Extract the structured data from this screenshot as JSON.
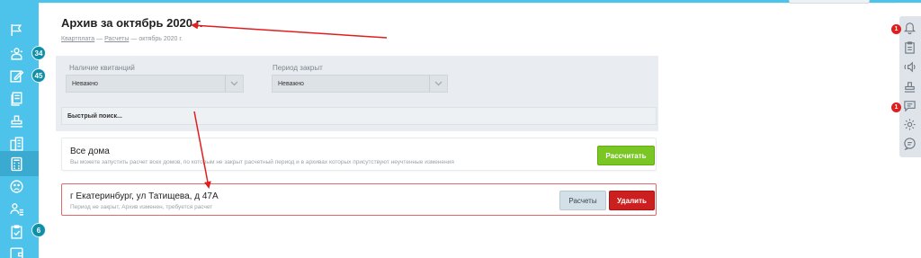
{
  "sidebar": {
    "items": [
      {
        "icon": "flag-icon"
      },
      {
        "icon": "groups-icon",
        "badge": "34"
      },
      {
        "icon": "edit-note-icon",
        "badge": "45"
      },
      {
        "icon": "documents-icon"
      },
      {
        "icon": "stamp-icon"
      },
      {
        "icon": "buildings-icon"
      },
      {
        "icon": "calculator-icon"
      },
      {
        "icon": "sad-face-icon"
      },
      {
        "icon": "users-list-icon"
      },
      {
        "icon": "clipboard-check-icon",
        "badge": "6"
      },
      {
        "icon": "wallet-icon"
      }
    ]
  },
  "right_rail": {
    "items": [
      {
        "icon": "bell-icon",
        "badge": "1"
      },
      {
        "icon": "clipboard-icon"
      },
      {
        "icon": "speaker-icon"
      },
      {
        "icon": "stamp-icon"
      },
      {
        "icon": "chat-icon",
        "badge": "1"
      },
      {
        "icon": "gear-icon"
      },
      {
        "icon": "support-chat-icon"
      }
    ]
  },
  "page": {
    "title": "Архив за октябрь 2020 г.",
    "breadcrumb": [
      "Квартплата",
      "Расчеты",
      "октябрь 2020 г."
    ],
    "breadcrumb_sep": "—"
  },
  "filters": {
    "receipts_label": "Наличие квитанций",
    "receipts_value": "Неважно",
    "period_label": "Период закрыт",
    "period_value": "Неважно",
    "quick_search_placeholder": "Быстрый поиск..."
  },
  "cards": {
    "all_houses": {
      "title": "Все дома",
      "subtitle": "Вы можете запустить расчет всех домов, по которым не закрыт расчетный период и в архивах которых присутствуют неучтенные изменения",
      "button": "Рассчитать"
    },
    "address": {
      "title": "г Екатеринбург, ул Татищева, д 47А",
      "subtitle": "Период не закрыт, Архив изменен, требуется расчет",
      "calc_button": "Расчеты",
      "delete_button": "Удалить"
    }
  },
  "colors": {
    "sidebar": "#4dc2ea",
    "accent_green": "#7ac624",
    "danger_red": "#cc1f1f",
    "annotation": "#e01e1e"
  }
}
